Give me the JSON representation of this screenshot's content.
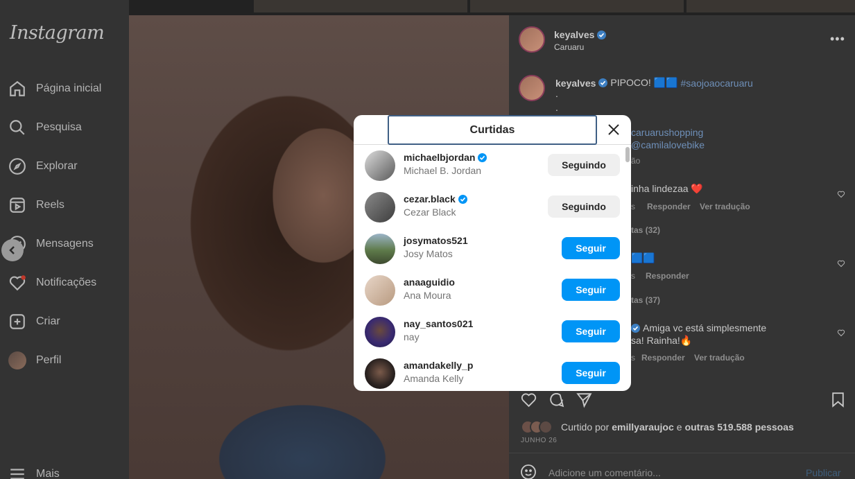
{
  "nav": {
    "logo": "Instagram",
    "items": [
      {
        "label": "Página inicial",
        "icon": "home-icon"
      },
      {
        "label": "Pesquisa",
        "icon": "search-icon"
      },
      {
        "label": "Explorar",
        "icon": "compass-icon"
      },
      {
        "label": "Reels",
        "icon": "reels-icon"
      },
      {
        "label": "Mensagens",
        "icon": "messenger-icon"
      },
      {
        "label": "Notificações",
        "icon": "heart-icon"
      },
      {
        "label": "Criar",
        "icon": "plus-square-icon"
      },
      {
        "label": "Perfil",
        "icon": "avatar"
      },
      {
        "label": "Mais",
        "icon": "menu-icon"
      }
    ]
  },
  "post": {
    "author": "keyalves",
    "location": "Caruaru",
    "caption_user": "keyalves",
    "caption_text": "PIPOCO! 🟦🟦",
    "caption_hashtag": "#saojoaocaruaru",
    "caption_dots": ".",
    "caption_mention1": "caruarushopping",
    "caption_mention2": "@camilalovebike",
    "caption_partial": "ão",
    "comments": [
      {
        "text": "inha lindezaa ❤️",
        "meta_a": "s",
        "reply": "Responder",
        "translate": "Ver tradução",
        "replies": "tas (32)"
      },
      {
        "text": "🟦🟦",
        "meta_a": "s",
        "reply": "Responder",
        "translate": "",
        "replies": "tas (37)"
      },
      {
        "text": "Amiga vc está simplesmente",
        "text2": "sa! Rainha!🔥",
        "meta_a": "s",
        "reply": "Responder",
        "translate": "Ver tradução"
      }
    ],
    "liked_by_prefix": "Curtido por",
    "liked_by_user": "emillyaraujoc",
    "liked_by_and": "e",
    "liked_by_others": "outras 519.588 pessoas",
    "date": "JUNHO 26",
    "comment_placeholder": "Adicione um comentário...",
    "publish_label": "Publicar"
  },
  "modal": {
    "title": "Curtidas",
    "users": [
      {
        "username": "michaelbjordan",
        "name": "Michael B. Jordan",
        "verified": true,
        "button": "Seguindo"
      },
      {
        "username": "cezar.black",
        "name": "Cezar Black",
        "verified": true,
        "button": "Seguindo"
      },
      {
        "username": "josymatos521",
        "name": "Josy Matos",
        "verified": false,
        "button": "Seguir"
      },
      {
        "username": "anaaguidio",
        "name": "Ana Moura",
        "verified": false,
        "button": "Seguir"
      },
      {
        "username": "nay_santos021",
        "name": "nay",
        "verified": false,
        "button": "Seguir"
      },
      {
        "username": "amandakelly_p",
        "name": "Amanda Kelly",
        "verified": false,
        "button": "Seguir"
      }
    ]
  },
  "colors": {
    "accent": "#0095f6",
    "verified": "#0095f6",
    "following_bg": "#efefef"
  }
}
